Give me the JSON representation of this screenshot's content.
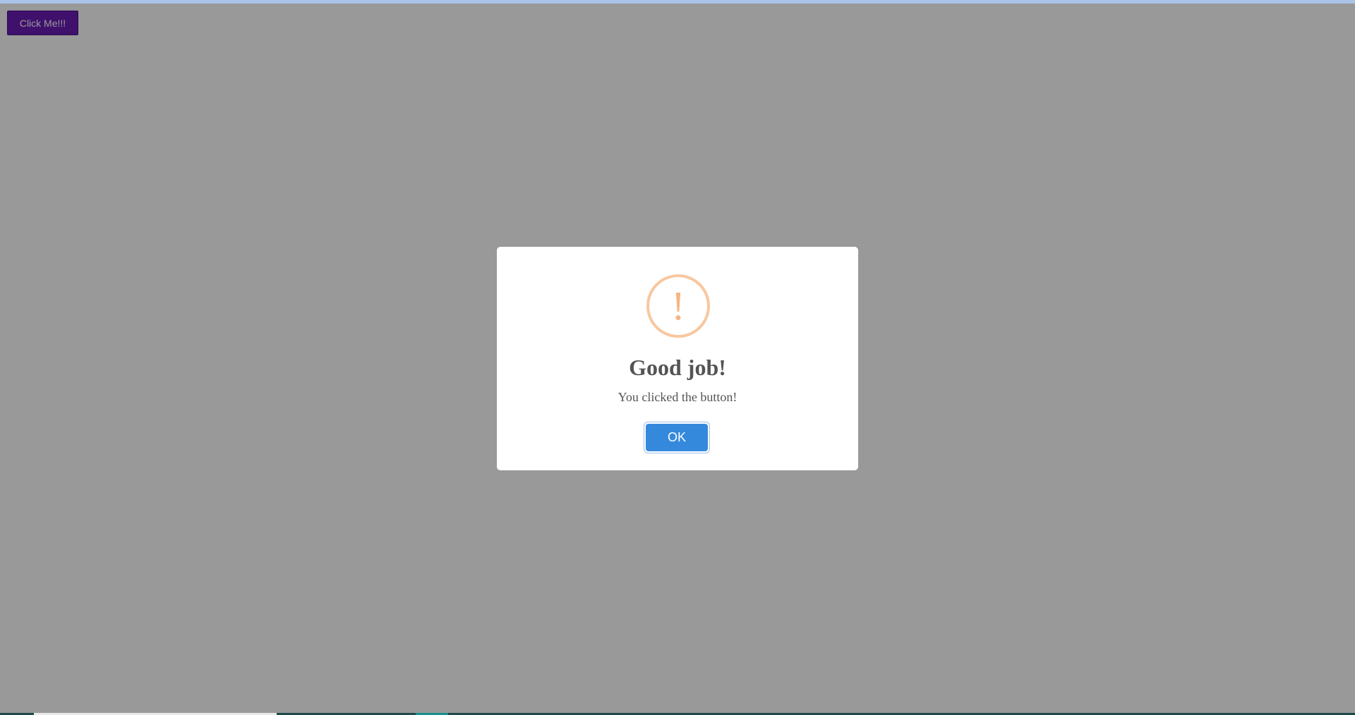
{
  "page": {
    "button_label": "Click Me!!!"
  },
  "dialog": {
    "icon": "warning-exclamation-icon",
    "icon_glyph": "!",
    "title": "Good job!",
    "text": "You clicked the button!",
    "ok_label": "OK"
  },
  "colors": {
    "page_button": "#6a1bb5",
    "ok_button": "#3589dc",
    "warning_icon": "#f8c79f",
    "overlay": "rgba(0,0,0,0.40)"
  }
}
